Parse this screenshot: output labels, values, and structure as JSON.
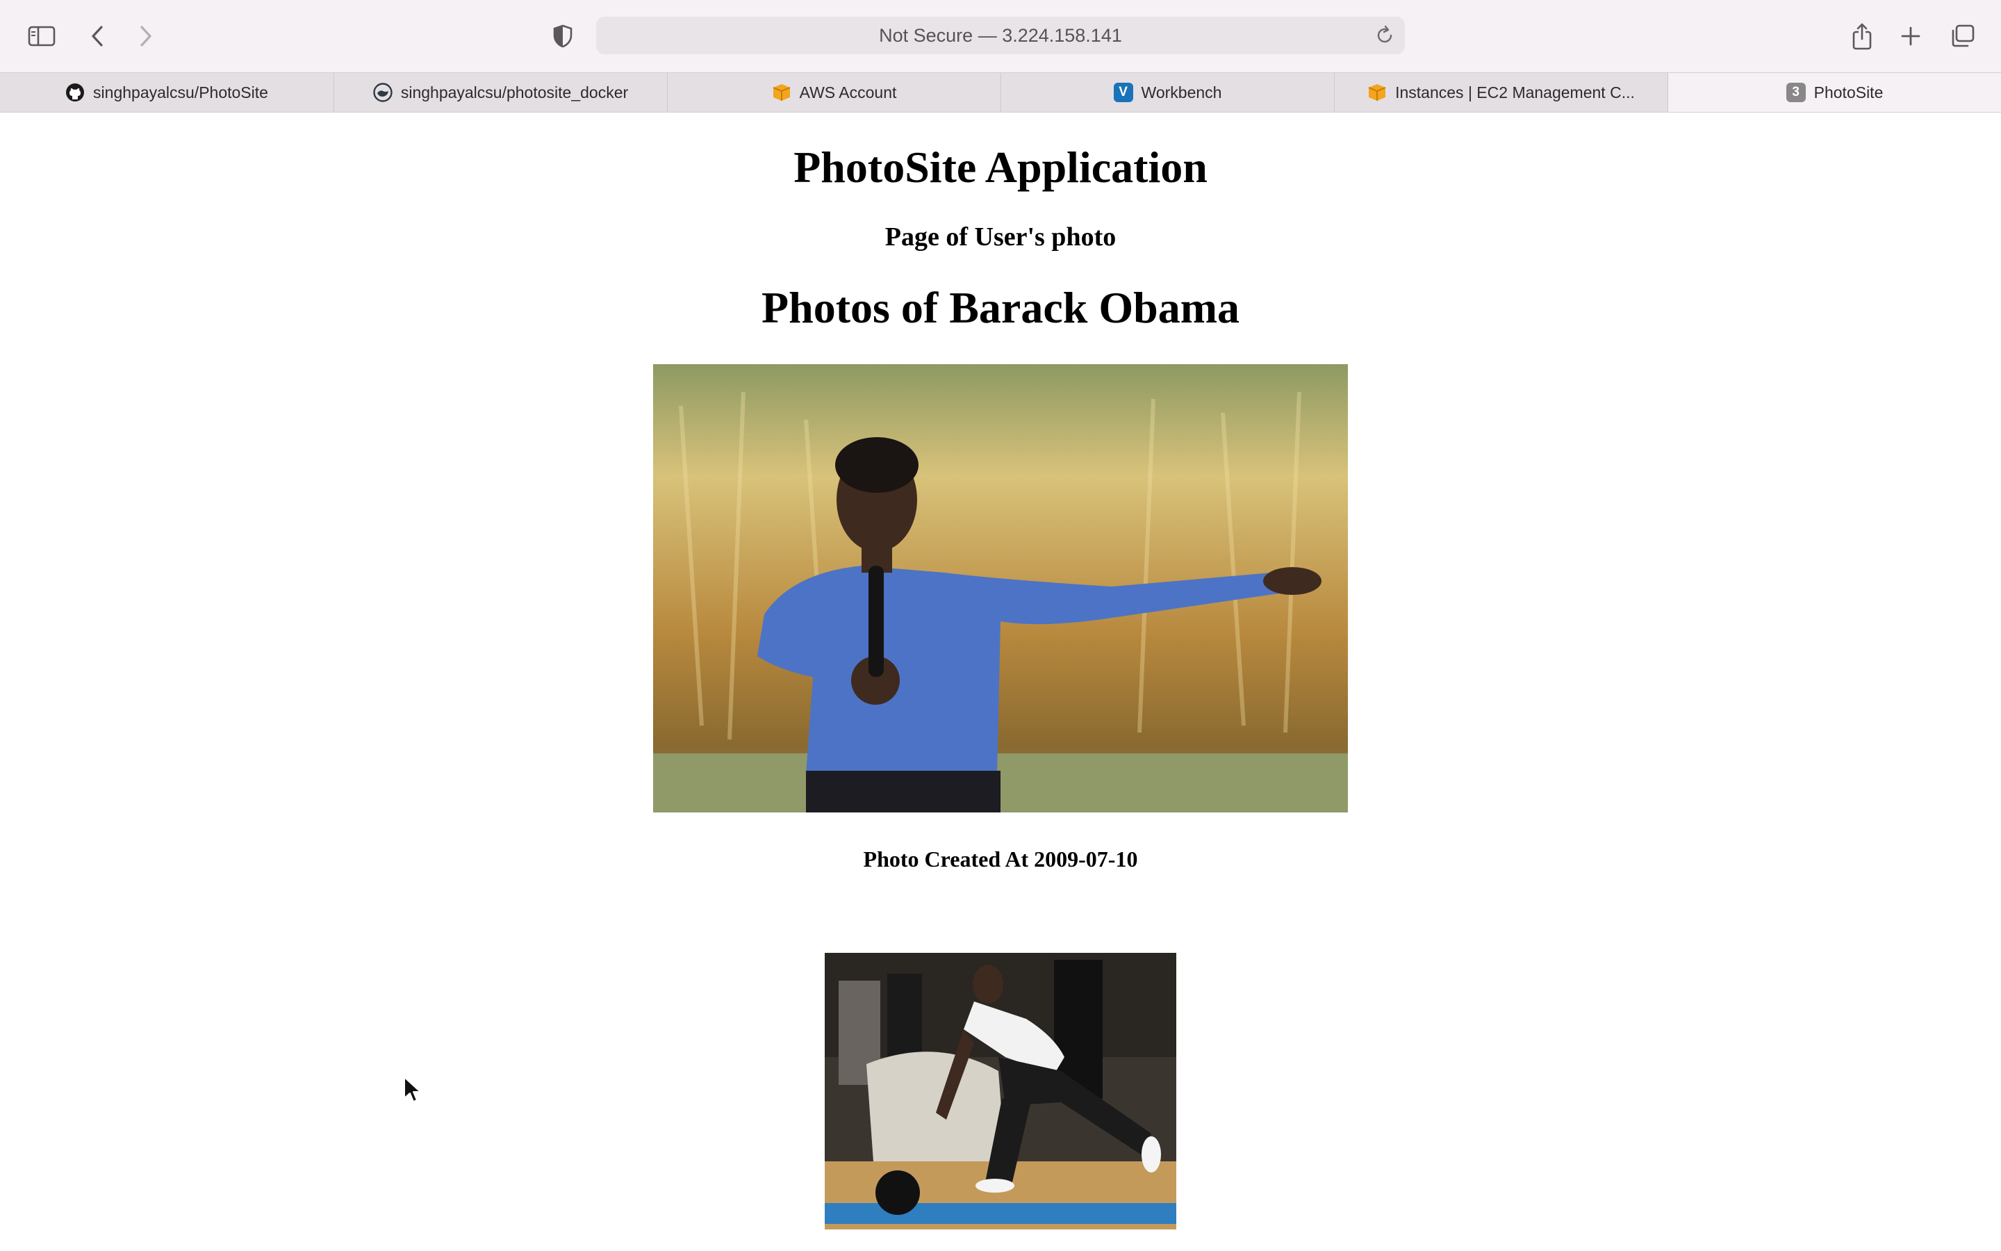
{
  "browser": {
    "address": "Not Secure — 3.224.158.141",
    "tabs": [
      {
        "label": "singhpayalcsu/PhotoSite",
        "icon": "github-icon"
      },
      {
        "label": "singhpayalcsu/photosite_docker",
        "icon": "docker-icon"
      },
      {
        "label": "AWS Account",
        "icon": "aws-box-icon"
      },
      {
        "label": "Workbench",
        "icon": "vocareum-icon"
      },
      {
        "label": "Instances | EC2 Management C...",
        "icon": "aws-box-icon"
      },
      {
        "label": "PhotoSite",
        "icon": "tab-number-icon",
        "badge": "3",
        "active": true
      }
    ],
    "icons": [
      "sidebar-icon",
      "back-icon",
      "forward-icon",
      "privacy-shield-icon",
      "reload-icon",
      "share-icon",
      "new-tab-icon",
      "tab-overview-icon"
    ]
  },
  "page": {
    "app_title": "PhotoSite Application",
    "subtitle": "Page of User's photo",
    "heading": "Photos of Barack Obama",
    "photos": [
      {
        "caption": "Photo Created At 2009-07-10"
      },
      {
        "caption": ""
      }
    ]
  },
  "colors": {
    "toolbar_bg": "#f6f1f4",
    "tabbar_bg": "#e4dfe3",
    "aws_orange": "#f2a51d",
    "vocareum_blue": "#1a73b8"
  }
}
